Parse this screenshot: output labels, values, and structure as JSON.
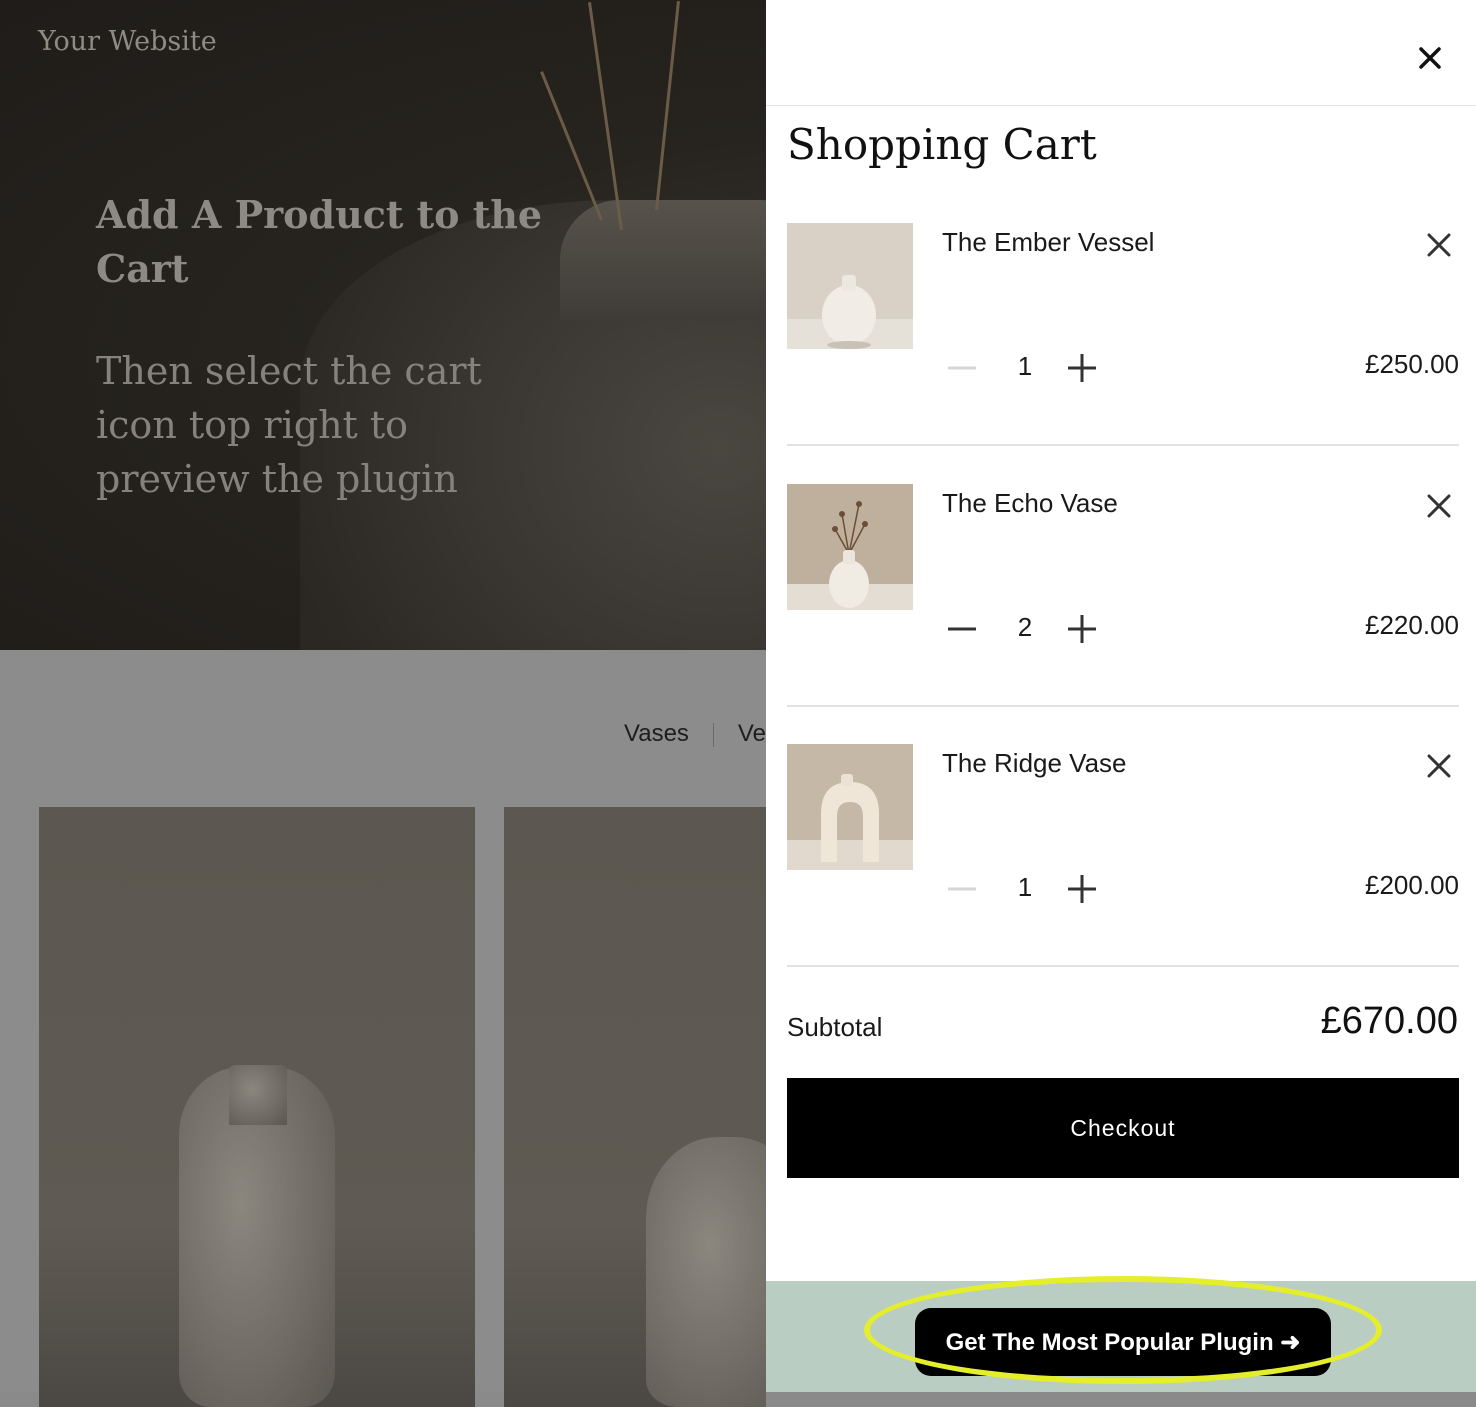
{
  "site": {
    "title": "Your Website",
    "hero_heading": "Add A Product to the Cart",
    "hero_sub": "Then select the cart icon top right to preview the plugin",
    "filters": [
      "Vases",
      "Ve"
    ]
  },
  "cart": {
    "title": "Shopping Cart",
    "close_icon": "close-icon",
    "items": [
      {
        "name": "The Ember Vessel",
        "qty": "1",
        "price": "£250.00"
      },
      {
        "name": "The Echo Vase",
        "qty": "2",
        "price": "£220.00"
      },
      {
        "name": "The Ridge Vase",
        "qty": "1",
        "price": "£200.00"
      }
    ],
    "subtotal_label": "Subtotal",
    "subtotal_value": "£670.00",
    "checkout_label": "Checkout"
  },
  "promo": {
    "button_label": "Get The Most Popular Plugin ➜",
    "highlight_color": "#e4ee2a"
  },
  "colors": {
    "drawer_bg": "#ffffff",
    "checkout_bg": "#000000",
    "promo_bg": "#b9cdc2"
  }
}
